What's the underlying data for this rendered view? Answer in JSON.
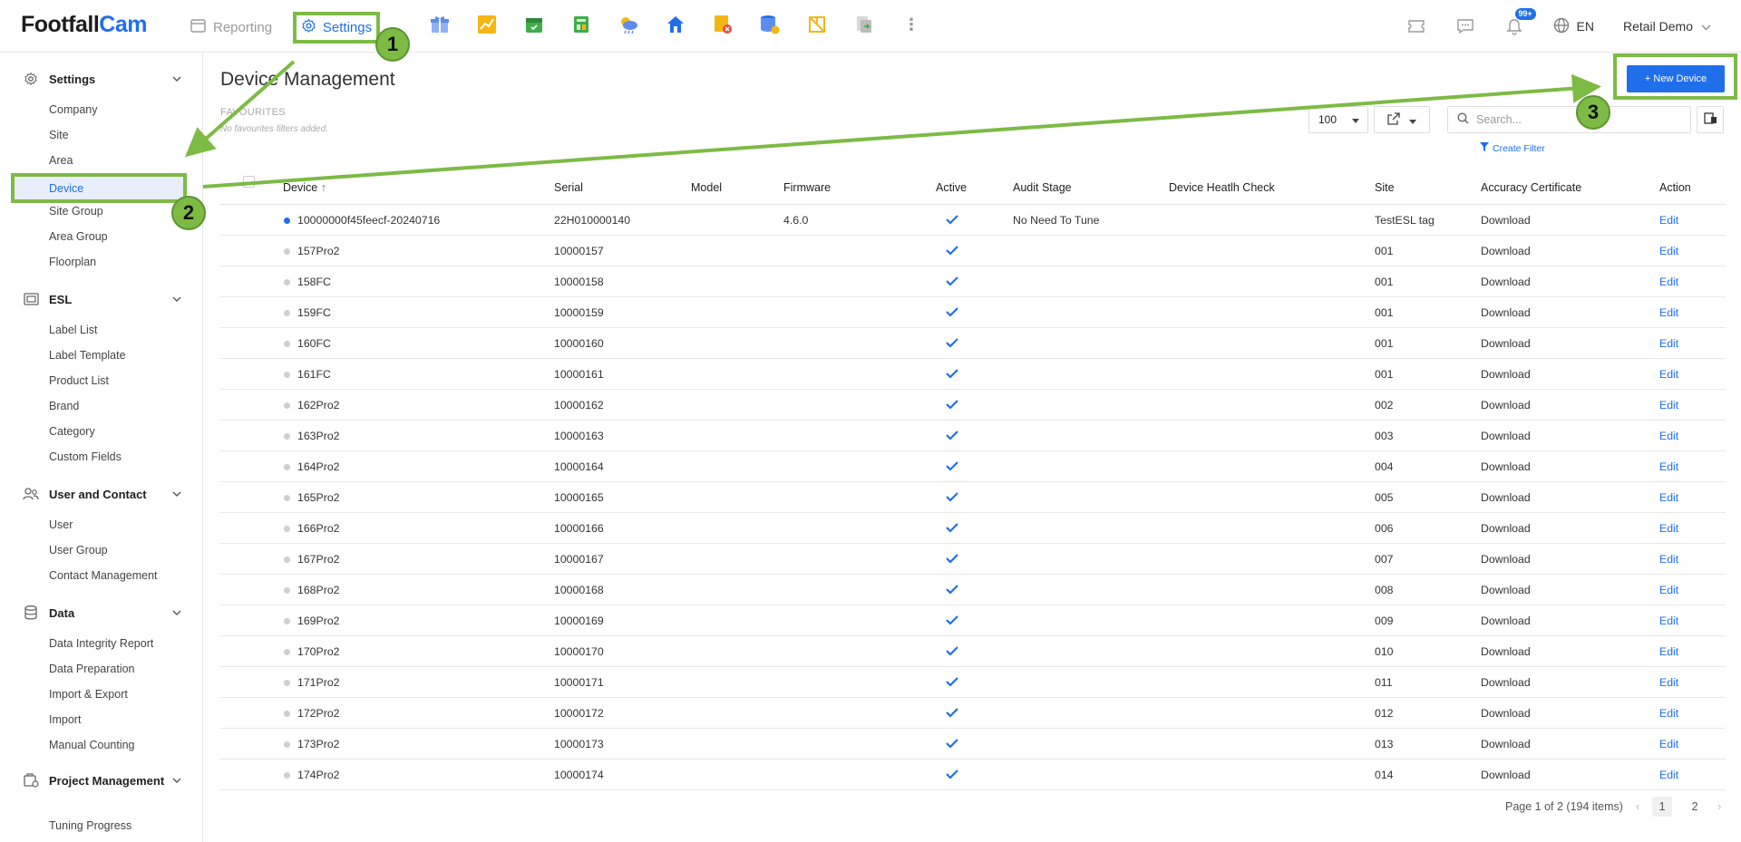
{
  "brand": {
    "part1": "Footfall",
    "part2": "Cam"
  },
  "topnav": {
    "reporting": "Reporting",
    "settings": "Settings",
    "apps": [
      {
        "icon": "gift-box-icon",
        "color": "#5b8def"
      },
      {
        "icon": "chart-icon",
        "color": "#f5b614"
      },
      {
        "icon": "calendar-icon",
        "color": "#3fae4a"
      },
      {
        "icon": "ledger-icon",
        "color": "#3fae4a"
      },
      {
        "icon": "weather-icon",
        "color": "#f5b614"
      },
      {
        "icon": "store-icon",
        "color": "#1f6feb"
      },
      {
        "icon": "tag-icon",
        "color": "#f5b614"
      },
      {
        "icon": "database-icon",
        "color": "#1f6feb"
      },
      {
        "icon": "floorplan-icon",
        "color": "#f5b614"
      },
      {
        "icon": "import-icon",
        "color": "#999999"
      }
    ],
    "notification_badge": "99+",
    "language": "EN",
    "user": "Retail Demo"
  },
  "sidebar": {
    "groups": [
      {
        "label": "Settings",
        "icon": "gear-icon",
        "items": [
          "Company",
          "Site",
          "Area",
          "Device",
          "Site Group",
          "Area Group",
          "Floorplan"
        ]
      },
      {
        "label": "ESL",
        "icon": "esl-display-icon",
        "items": [
          "Label List",
          "Label Template",
          "Product List",
          "Brand",
          "Category",
          "Custom Fields"
        ]
      },
      {
        "label": "User and Contact",
        "icon": "users-icon",
        "items": [
          "User",
          "User Group",
          "Contact Management"
        ]
      },
      {
        "label": "Data",
        "icon": "database-icon",
        "items": [
          "Data Integrity Report",
          "Data Preparation",
          "Import & Export",
          "Import",
          "Manual Counting"
        ]
      },
      {
        "label": "Project Management",
        "icon": "project-icon",
        "items": [
          "Tuning Progress"
        ]
      }
    ],
    "active_item": "Device"
  },
  "page": {
    "title": "Device Management",
    "favourites_label": "FAVOURITES",
    "favourites_note": "No favourites filters added.",
    "new_device": "+ New Device",
    "page_size": "100",
    "search_placeholder": "Search...",
    "create_filter": "Create Filter"
  },
  "table": {
    "headers": {
      "device": "Device",
      "serial": "Serial",
      "model": "Model",
      "firmware": "Firmware",
      "active": "Active",
      "audit": "Audit Stage",
      "health": "Device Heatlh Check",
      "site": "Site",
      "certificate": "Accuracy Certificate",
      "action": "Action"
    },
    "rows": [
      {
        "device": "10000000f45feecf-20240716",
        "serial": "22H010000140",
        "model": "",
        "firmware": "4.6.0",
        "active": true,
        "audit": "No Need To Tune",
        "health": "",
        "site": "TestESL tag",
        "certificate": "Download",
        "action": "Edit",
        "online": true
      },
      {
        "device": "157Pro2",
        "serial": "10000157",
        "model": "",
        "firmware": "",
        "active": true,
        "audit": "",
        "health": "",
        "site": "001",
        "certificate": "Download",
        "action": "Edit",
        "online": false
      },
      {
        "device": "158FC",
        "serial": "10000158",
        "model": "",
        "firmware": "",
        "active": true,
        "audit": "",
        "health": "",
        "site": "001",
        "certificate": "Download",
        "action": "Edit",
        "online": false
      },
      {
        "device": "159FC",
        "serial": "10000159",
        "model": "",
        "firmware": "",
        "active": true,
        "audit": "",
        "health": "",
        "site": "001",
        "certificate": "Download",
        "action": "Edit",
        "online": false
      },
      {
        "device": "160FC",
        "serial": "10000160",
        "model": "",
        "firmware": "",
        "active": true,
        "audit": "",
        "health": "",
        "site": "001",
        "certificate": "Download",
        "action": "Edit",
        "online": false
      },
      {
        "device": "161FC",
        "serial": "10000161",
        "model": "",
        "firmware": "",
        "active": true,
        "audit": "",
        "health": "",
        "site": "001",
        "certificate": "Download",
        "action": "Edit",
        "online": false
      },
      {
        "device": "162Pro2",
        "serial": "10000162",
        "model": "",
        "firmware": "",
        "active": true,
        "audit": "",
        "health": "",
        "site": "002",
        "certificate": "Download",
        "action": "Edit",
        "online": false
      },
      {
        "device": "163Pro2",
        "serial": "10000163",
        "model": "",
        "firmware": "",
        "active": true,
        "audit": "",
        "health": "",
        "site": "003",
        "certificate": "Download",
        "action": "Edit",
        "online": false
      },
      {
        "device": "164Pro2",
        "serial": "10000164",
        "model": "",
        "firmware": "",
        "active": true,
        "audit": "",
        "health": "",
        "site": "004",
        "certificate": "Download",
        "action": "Edit",
        "online": false
      },
      {
        "device": "165Pro2",
        "serial": "10000165",
        "model": "",
        "firmware": "",
        "active": true,
        "audit": "",
        "health": "",
        "site": "005",
        "certificate": "Download",
        "action": "Edit",
        "online": false
      },
      {
        "device": "166Pro2",
        "serial": "10000166",
        "model": "",
        "firmware": "",
        "active": true,
        "audit": "",
        "health": "",
        "site": "006",
        "certificate": "Download",
        "action": "Edit",
        "online": false
      },
      {
        "device": "167Pro2",
        "serial": "10000167",
        "model": "",
        "firmware": "",
        "active": true,
        "audit": "",
        "health": "",
        "site": "007",
        "certificate": "Download",
        "action": "Edit",
        "online": false
      },
      {
        "device": "168Pro2",
        "serial": "10000168",
        "model": "",
        "firmware": "",
        "active": true,
        "audit": "",
        "health": "",
        "site": "008",
        "certificate": "Download",
        "action": "Edit",
        "online": false
      },
      {
        "device": "169Pro2",
        "serial": "10000169",
        "model": "",
        "firmware": "",
        "active": true,
        "audit": "",
        "health": "",
        "site": "009",
        "certificate": "Download",
        "action": "Edit",
        "online": false
      },
      {
        "device": "170Pro2",
        "serial": "10000170",
        "model": "",
        "firmware": "",
        "active": true,
        "audit": "",
        "health": "",
        "site": "010",
        "certificate": "Download",
        "action": "Edit",
        "online": false
      },
      {
        "device": "171Pro2",
        "serial": "10000171",
        "model": "",
        "firmware": "",
        "active": true,
        "audit": "",
        "health": "",
        "site": "011",
        "certificate": "Download",
        "action": "Edit",
        "online": false
      },
      {
        "device": "172Pro2",
        "serial": "10000172",
        "model": "",
        "firmware": "",
        "active": true,
        "audit": "",
        "health": "",
        "site": "012",
        "certificate": "Download",
        "action": "Edit",
        "online": false
      },
      {
        "device": "173Pro2",
        "serial": "10000173",
        "model": "",
        "firmware": "",
        "active": true,
        "audit": "",
        "health": "",
        "site": "013",
        "certificate": "Download",
        "action": "Edit",
        "online": false
      },
      {
        "device": "174Pro2",
        "serial": "10000174",
        "model": "",
        "firmware": "",
        "active": true,
        "audit": "",
        "health": "",
        "site": "014",
        "certificate": "Download",
        "action": "Edit",
        "online": false
      }
    ]
  },
  "pagination": {
    "summary": "Page 1 of 2 (194 items)",
    "pages": [
      "1",
      "2"
    ],
    "current": "1"
  },
  "callouts": [
    "1",
    "2",
    "3"
  ],
  "colors": {
    "accent": "#1f6feb",
    "annotation": "#7dbb45"
  }
}
